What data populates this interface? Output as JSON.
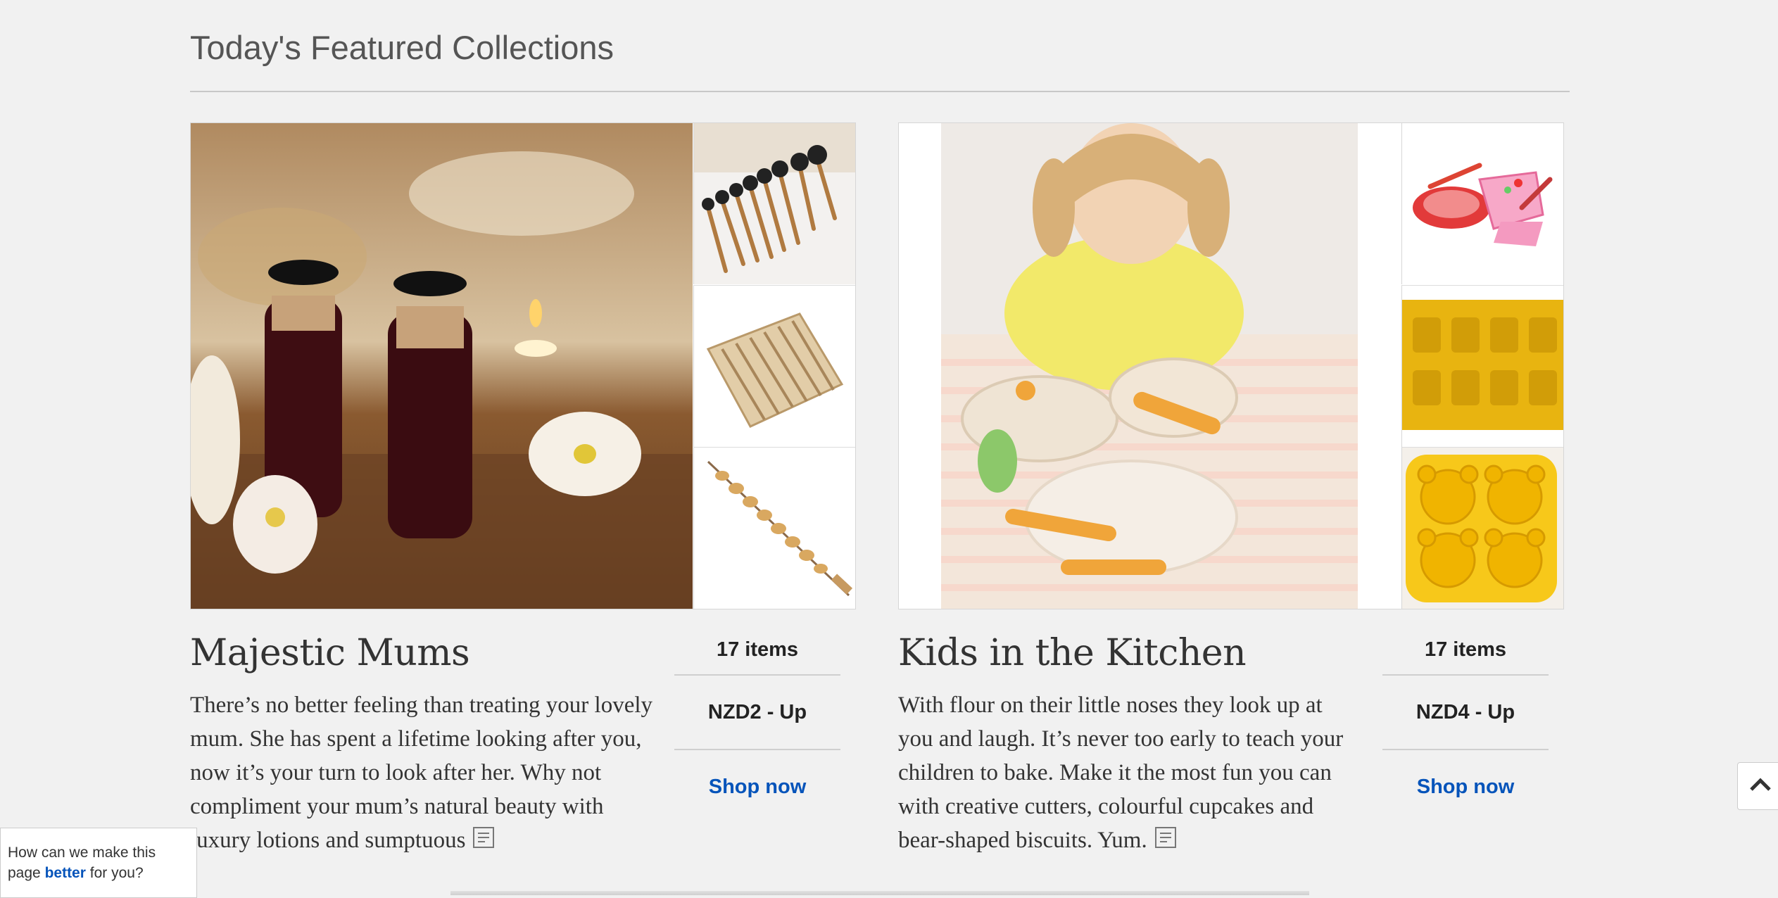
{
  "section": {
    "title": "Today's Featured Collections"
  },
  "collections": [
    {
      "title": "Majestic Mums",
      "description": "There’s no better feeling than treating your lovely mum. She has spent a lifetime looking after you, now it’s your turn to look after her. Why not compliment your mum’s natural beauty with luxury lotions and sumptuous",
      "items": "17 items",
      "price": "NZD2 - Up",
      "shop_label": "Shop now",
      "hero_image": "spa-oil-bottles-flowers",
      "thumbnails": [
        "makeup-brush-set",
        "wooden-foot-roller",
        "wooden-bead-massager"
      ]
    },
    {
      "title": "Kids in the Kitchen",
      "description": "With flour on their little noses they look up at you and laugh. It’s never too early to teach your children to bake. Make it the most fun you can with creative cutters, colourful cupcakes and bear-shaped biscuits. Yum.",
      "items": "17 items",
      "price": "NZD4 - Up",
      "shop_label": "Shop now",
      "hero_image": "girl-playing-toy-kitchen",
      "thumbnails": [
        "toy-cake-set",
        "yellow-silicone-mold",
        "bear-shaped-mold"
      ]
    }
  ],
  "feedback": {
    "text_before": "How can we make this page",
    "link": "better",
    "text_after": "for you?"
  },
  "icons": {
    "description": "description-icon",
    "back_to_top": "chevron-up-icon"
  },
  "colors": {
    "link": "#0654ba",
    "background": "#f1f1f1"
  }
}
